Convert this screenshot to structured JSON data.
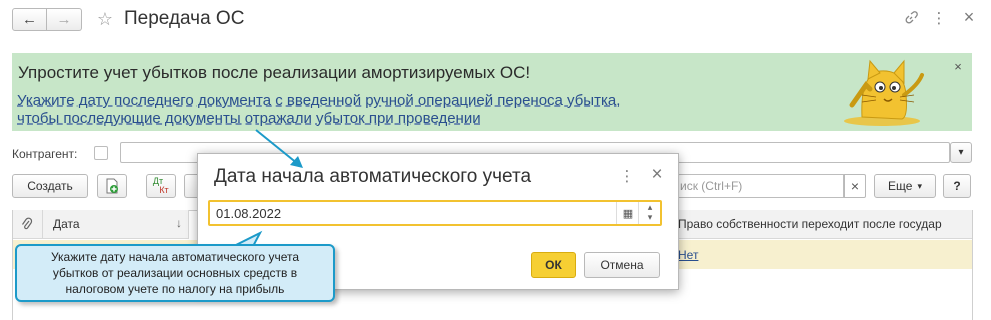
{
  "window": {
    "title": "Передача ОС",
    "back_glyph": "←",
    "forward_glyph": "→",
    "star_glyph": "☆",
    "link_glyph": "🔗",
    "more_glyph": "⋮",
    "close_glyph": "×"
  },
  "banner": {
    "headline": "Упростите учет убытков после реализации амортизируемых ОС!",
    "link_line1": "Укажите дату последнего документа с введенной ручной операцией переноса убытка,",
    "link_line2": "чтобы последующие документы отражали убыток при проведении",
    "close_glyph": "×"
  },
  "filter": {
    "counterparty_label": "Контрагент:",
    "dropdown_glyph": "▾"
  },
  "toolbar": {
    "create_label": "Создать",
    "dtkt_top": "Дт",
    "dtkt_bottom": "Кт",
    "search_placeholder": "иск (Ctrl+F)",
    "clear_glyph": "×",
    "more_label": "Еще",
    "more_caret": "▾",
    "help_label": "?"
  },
  "grid": {
    "col_clip_glyph": "📎",
    "col_date": "Дата",
    "sort_glyph": "↓",
    "col_right": "Право собственности переходит после государ",
    "row_link": "Нет"
  },
  "dialog": {
    "title": "Дата начала автоматического учета",
    "more_glyph": "⋮",
    "close_glyph": "×",
    "date_value": "01.08.2022",
    "calendar_glyph": "▦",
    "up_glyph": "▴",
    "down_glyph": "▾",
    "ok_label": "ОК",
    "cancel_label": "Отмена"
  },
  "tooltip": {
    "text": "Укажите дату начала автоматического учета убытков от реализации основных средств в налоговом учете по налогу на прибыль"
  },
  "colors": {
    "banner_bg": "#c7e6c8",
    "accent_yellow": "#f2c230",
    "tooltip_border": "#1c9ac9",
    "link": "#2a4f8e"
  }
}
